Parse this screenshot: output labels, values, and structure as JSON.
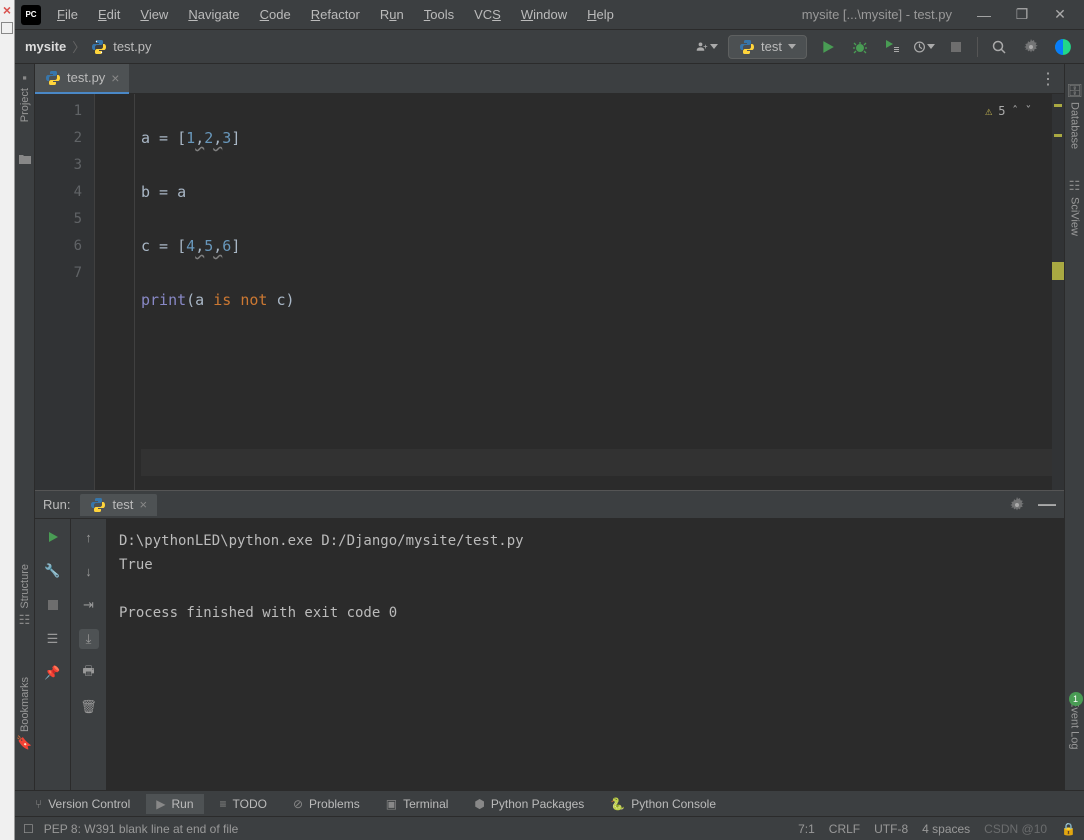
{
  "titlebar": {
    "project_title": "mysite [...\\mysite] - test.py"
  },
  "menu": {
    "file": "File",
    "edit": "Edit",
    "view": "View",
    "navigate": "Navigate",
    "code": "Code",
    "refactor": "Refactor",
    "run": "Run",
    "tools": "Tools",
    "vcs": "VCS",
    "window": "Window",
    "help": "Help"
  },
  "breadcrumb": {
    "root": "mysite",
    "file": "test.py"
  },
  "run_config": "test",
  "file_tab": "test.py",
  "code": {
    "lines": [
      "1",
      "2",
      "3",
      "4",
      "5",
      "6",
      "7"
    ],
    "l1a": "a = [",
    "l1n1": "1",
    "l1c1": ",",
    "l1n2": "2",
    "l1c2": ",",
    "l1n3": "3",
    "l1b": "]",
    "l2": "b = a",
    "l3a": "c = [",
    "l3n1": "4",
    "l3c1": ",",
    "l3n2": "5",
    "l3c2": ",",
    "l3n3": "6",
    "l3b": "]",
    "l4a": "print",
    "l4b": "(a ",
    "l4kw": "is not",
    "l4c": " c)"
  },
  "inspection": {
    "warning_count": "5"
  },
  "run_panel": {
    "label": "Run:",
    "tab": "test",
    "output_line1": "D:\\pythonLED\\python.exe D:/Django/mysite/test.py",
    "output_line2": "True",
    "output_line3": "",
    "output_line4": "Process finished with exit code 0"
  },
  "bottom_tabs": {
    "vcs": "Version Control",
    "run": "Run",
    "todo": "TODO",
    "problems": "Problems",
    "terminal": "Terminal",
    "packages": "Python Packages",
    "console": "Python Console"
  },
  "left_tools": {
    "project": "Project",
    "structure": "Structure",
    "bookmarks": "Bookmarks"
  },
  "right_tools": {
    "database": "Database",
    "sciview": "SciView",
    "eventlog": "Event Log"
  },
  "status": {
    "msg": "PEP 8: W391 blank line at end of file",
    "pos": "7:1",
    "eol": "CRLF",
    "enc": "UTF-8",
    "indent": "4 spaces",
    "watermark": "CSDN @10"
  },
  "event_badge": "1"
}
